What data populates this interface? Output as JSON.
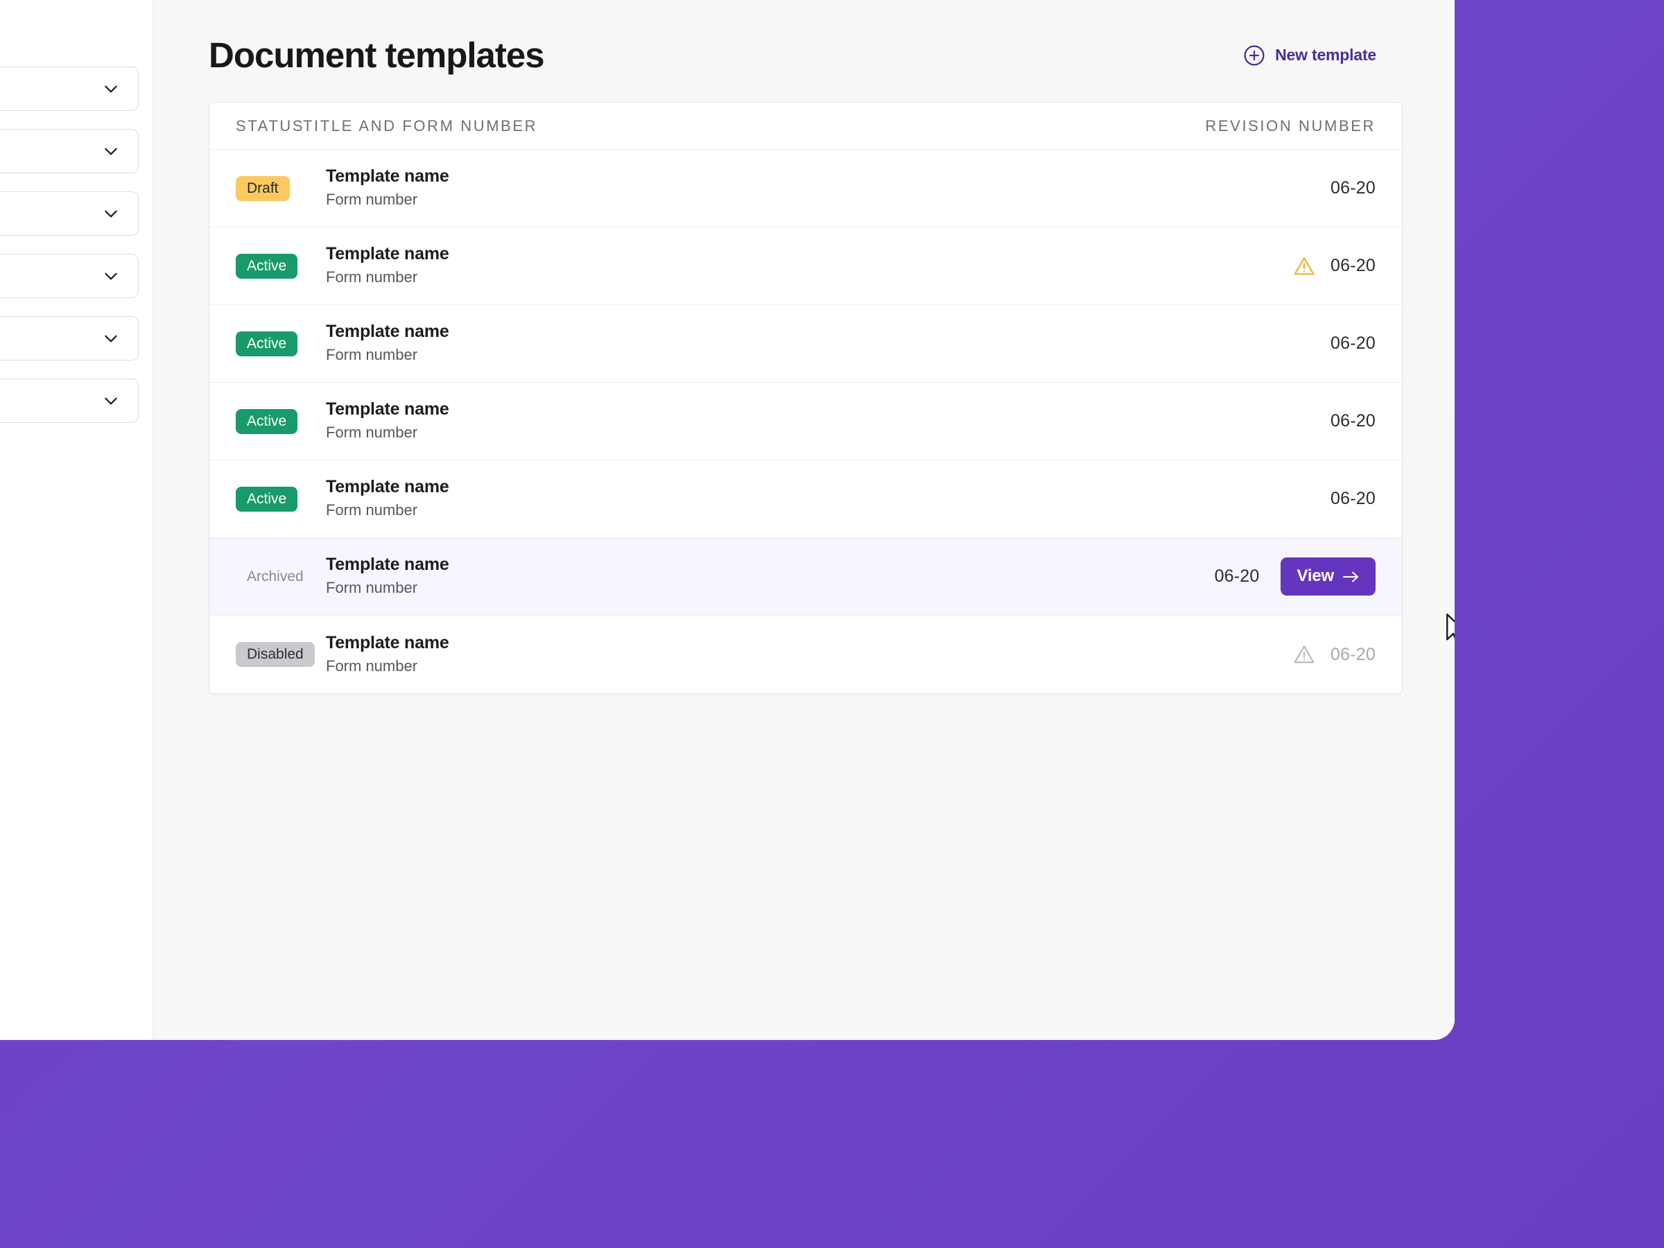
{
  "app": {
    "background_color": "#6639BF",
    "surface_color": "#F7F7F8",
    "accent_color": "#6535C0"
  },
  "sidebar": {
    "items": [
      {
        "icon": "chevron-down-icon",
        "label": ""
      },
      {
        "icon": "chevron-down-icon",
        "label": ""
      },
      {
        "icon": "chevron-down-icon",
        "label": ""
      },
      {
        "icon": "chevron-down-icon",
        "label": ""
      },
      {
        "icon": "chevron-down-icon",
        "label": ""
      },
      {
        "icon": "chevron-down-icon",
        "label": ""
      }
    ]
  },
  "header": {
    "title": "Document templates",
    "new_template_label": "New template",
    "new_template_icon": "plus-circle-icon"
  },
  "table": {
    "columns": {
      "status": "STATUS",
      "title": "TITLE AND FORM NUMBER",
      "revision": "REVISION NUMBER"
    },
    "rows": [
      {
        "status": "Draft",
        "status_style": "draft",
        "name": "Template name",
        "form": "Form number",
        "revision": "06-20",
        "warning": false,
        "highlight": false,
        "muted": false,
        "action": null
      },
      {
        "status": "Active",
        "status_style": "active",
        "name": "Template name",
        "form": "Form number",
        "revision": "06-20",
        "warning": true,
        "highlight": false,
        "muted": false,
        "action": null
      },
      {
        "status": "Active",
        "status_style": "active",
        "name": "Template name",
        "form": "Form number",
        "revision": "06-20",
        "warning": false,
        "highlight": false,
        "muted": false,
        "action": null
      },
      {
        "status": "Active",
        "status_style": "active",
        "name": "Template name",
        "form": "Form number",
        "revision": "06-20",
        "warning": false,
        "highlight": false,
        "muted": false,
        "action": null
      },
      {
        "status": "Active",
        "status_style": "active",
        "name": "Template name",
        "form": "Form number",
        "revision": "06-20",
        "warning": false,
        "highlight": false,
        "muted": false,
        "action": null
      },
      {
        "status": "Archived",
        "status_style": "archived",
        "name": "Template name",
        "form": "Form number",
        "revision": "06-20",
        "warning": false,
        "highlight": true,
        "muted": false,
        "action": "View"
      },
      {
        "status": "Disabled",
        "status_style": "disabled",
        "name": "Template name",
        "form": "Form number",
        "revision": "06-20",
        "warning": true,
        "highlight": false,
        "muted": true,
        "action": null
      }
    ]
  },
  "cursor": {
    "icon": "mouse-pointer-icon"
  }
}
